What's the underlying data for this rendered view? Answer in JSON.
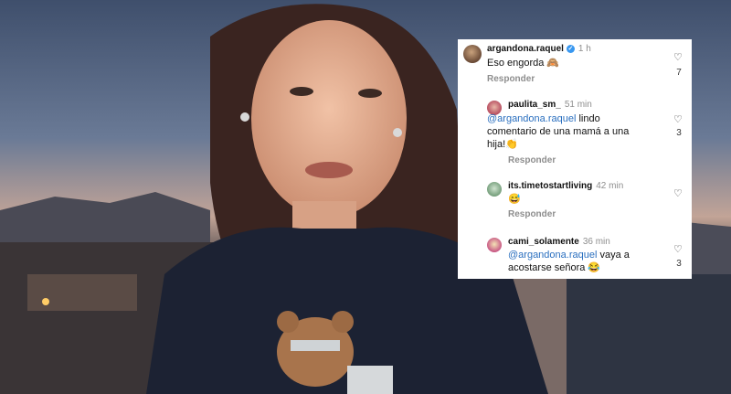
{
  "comments": [
    {
      "username": "argandona.raquel",
      "verified": true,
      "time": "1 h",
      "text": "Eso engorda 🙈",
      "reply_label": "Responder",
      "likes": "7"
    },
    {
      "username": "paulita_sm_",
      "time": "51 min",
      "mention": "@argandona.raquel",
      "text_after_mention": " lindo",
      "text_line2": "comentario de una mamá a una",
      "text_line3": "hija!👏",
      "reply_label": "Responder",
      "likes": "3"
    },
    {
      "username": "its.timetostartliving",
      "time": "42 min",
      "text": "😅",
      "reply_label": "Responder"
    },
    {
      "username": "cami_solamente",
      "time": "36 min",
      "mention": "@argandona.raquel",
      "text_after_mention": " vaya a",
      "text_line2": "acostarse señora 😂",
      "likes": "3"
    }
  ],
  "colors": {
    "mention": "#2a6fbf",
    "verified": "#3897f0",
    "secondary_text": "#8e8e8e"
  }
}
